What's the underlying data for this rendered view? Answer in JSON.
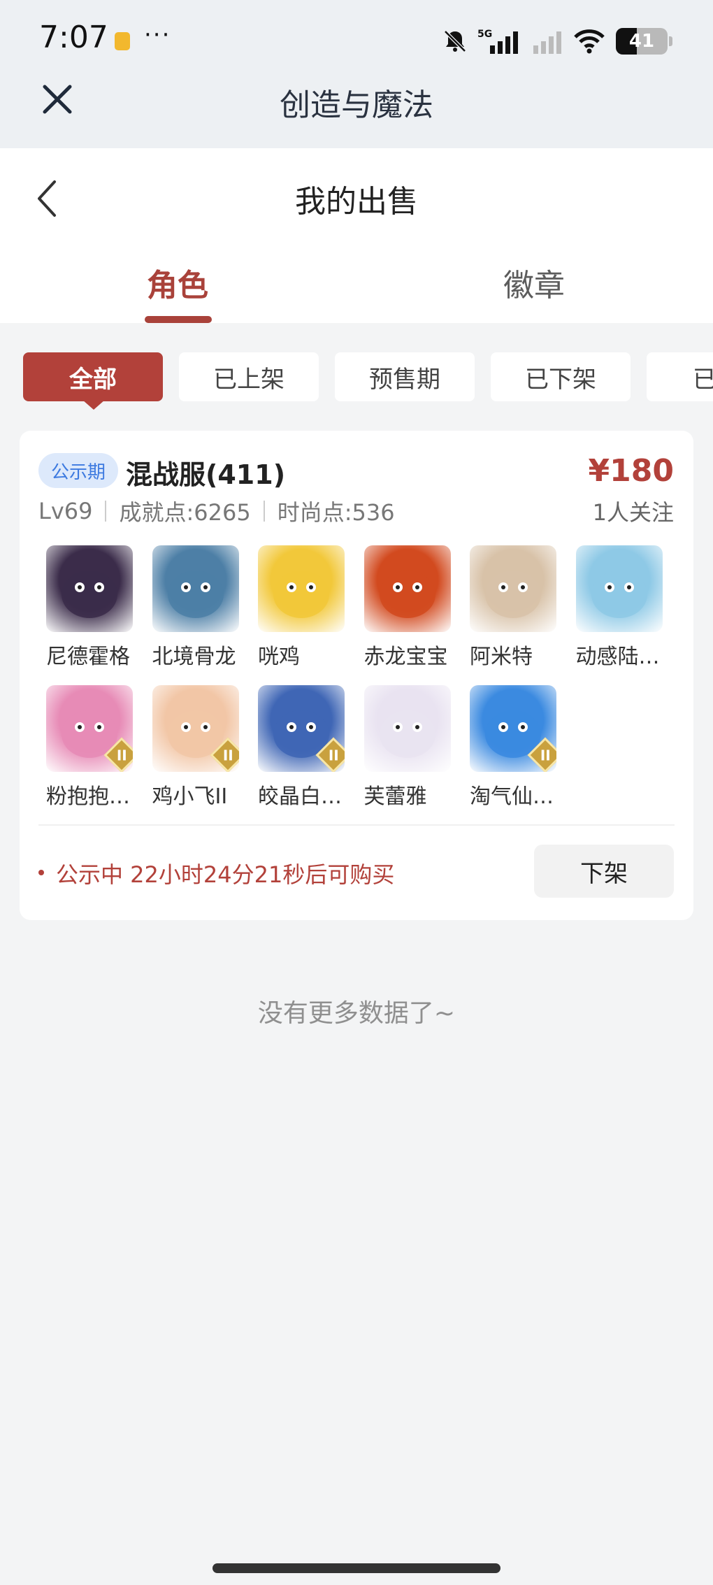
{
  "status_bar": {
    "time": "7:07",
    "dots": "···",
    "battery": "41",
    "battery_level": 0.41,
    "network": "5G"
  },
  "mp_header": {
    "title": "创造与魔法"
  },
  "page": {
    "title": "我的出售"
  },
  "tabs": [
    {
      "label": "角色",
      "active": true
    },
    {
      "label": "徽章",
      "active": false
    }
  ],
  "filters": [
    {
      "label": "全部",
      "active": true
    },
    {
      "label": "已上架",
      "active": false
    },
    {
      "label": "预售期",
      "active": false
    },
    {
      "label": "已下架",
      "active": false
    },
    {
      "label": "已售",
      "active": false
    }
  ],
  "listing": {
    "badge": "公示期",
    "server": "混战服(411)",
    "price": "¥180",
    "level": "Lv69",
    "achievement": "成就点:6265",
    "fashion": "时尚点:536",
    "followers": "1人关注",
    "pets": [
      {
        "name": "尼德霍格",
        "icon": "dark-dragon-icon",
        "color": "#3b2c4a",
        "tier": ""
      },
      {
        "name": "北境骨龙",
        "icon": "bone-dragon-icon",
        "color": "#4d7fa6",
        "tier": ""
      },
      {
        "name": "咣鸡",
        "icon": "chicken-icon",
        "color": "#f2c83a",
        "tier": ""
      },
      {
        "name": "赤龙宝宝",
        "icon": "red-dragon-icon",
        "color": "#d24a1f",
        "tier": ""
      },
      {
        "name": "阿米特",
        "icon": "crocodile-icon",
        "color": "#d8c2a8",
        "tier": ""
      },
      {
        "name": "动感陆…",
        "icon": "bird-icon",
        "color": "#8ec9e6",
        "tier": ""
      },
      {
        "name": "粉抱抱…",
        "icon": "pink-bear-icon",
        "color": "#e78bb6",
        "tier": "II"
      },
      {
        "name": "鸡小飞II",
        "icon": "fighter-icon",
        "color": "#f2c6a6",
        "tier": "II"
      },
      {
        "name": "皎晶白…",
        "icon": "white-tiger-icon",
        "color": "#3f66b5",
        "tier": "II"
      },
      {
        "name": "芙蕾雅",
        "icon": "goddess-icon",
        "color": "#e9e3f1",
        "tier": ""
      },
      {
        "name": "淘气仙…",
        "icon": "blue-dog-icon",
        "color": "#3b8ae0",
        "tier": "II"
      }
    ],
    "status": "公示中 22小时24分21秒后可购买",
    "delist_button": "下架"
  },
  "footer": {
    "no_more": "没有更多数据了~"
  }
}
